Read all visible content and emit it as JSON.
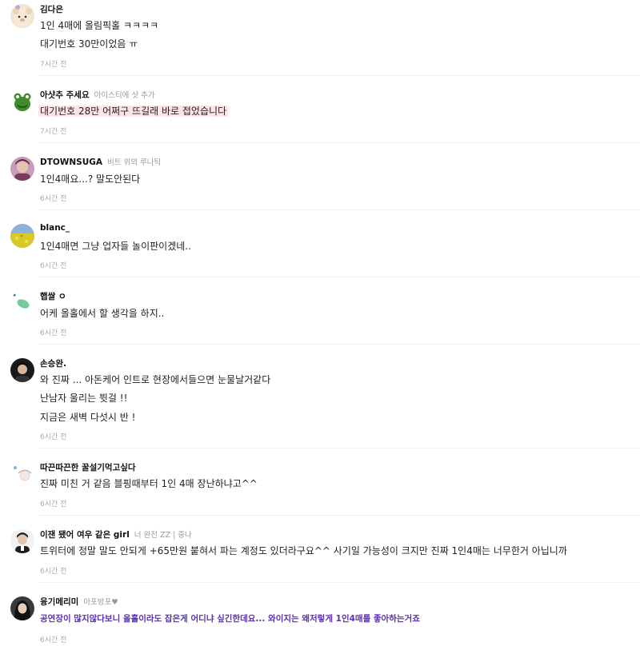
{
  "comments": [
    {
      "nickname": "김다은",
      "badge": "",
      "lines": [
        "1인 4매에 올림픽홀 ㅋㅋㅋㅋ",
        "대기번호 30만이었음 ㅠ"
      ],
      "time": "7시간 전",
      "avatar": "bear-avatar-icon"
    },
    {
      "nickname": "아샷추 주세요",
      "badge": "아이스티에 샷 추가",
      "lines": [
        "대기번호 28만 어쩌구 뜨길래 바로 접었습니다"
      ],
      "time": "7시간 전",
      "avatar": "frog-avatar-icon"
    },
    {
      "nickname": "DTOWNSUGA",
      "badge": "비트 위의 루나틱",
      "lines": [
        "1인4매요...? 말도안된다"
      ],
      "time": "6시간 전",
      "avatar": "person-avatar-icon"
    },
    {
      "nickname": "blanc_",
      "badge": "",
      "lines": [
        "1인4매면 그냥 업자들 놀이판이겠네.."
      ],
      "time": "6시간 전",
      "avatar": "flower-field-avatar-icon"
    },
    {
      "nickname": "햅쌀 ㅇ",
      "badge": "",
      "lines": [
        "어케 올홀에서 할 생각을 하지.."
      ],
      "time": "6시간 전",
      "avatar": "leaf-avatar-icon"
    },
    {
      "nickname": "손승완.",
      "badge": "",
      "lines": [
        "와 진짜 ... 아돈케어 인트로 현장에서들으면 눈물날거같다",
        "난남자 울리는 뷧걸 !!",
        "지금은 새벽 다섯시 반 !"
      ],
      "time": "6시간 전",
      "avatar": "dark-person-avatar-icon"
    },
    {
      "nickname": "따끈따끈한 꿀설기먹고싶다",
      "badge": "",
      "lines": [
        "진짜 미친 거 같음 블핑때부터 1인 4매 장난하냐고^^"
      ],
      "time": "6시간 전",
      "avatar": "sketch-avatar-icon"
    },
    {
      "nickname": "이잰 됐어 여우 같은 girl",
      "badge": "너 완전 ZZ | 중나",
      "lines": [
        "트위터에 정말 말도 안되게 +65만원 붙혀서 파는 계정도 있더라구요^^ 사기일 가능성이 크지만 진짜 1인4매는 너무한거 아닙니까"
      ],
      "time": "6시간 전",
      "avatar": "man-avatar-icon"
    },
    {
      "nickname": "융기메리미",
      "badge": "아포방포♥",
      "lines": [
        "공연장이 많지않다보니 올홀이라도 잡은게 어디냐 싶긴한데요... 와이지는 왜저렇게 1인4매를 좋아하는거죠"
      ],
      "time": "6시간 전",
      "avatar": "woman-avatar-icon"
    }
  ]
}
